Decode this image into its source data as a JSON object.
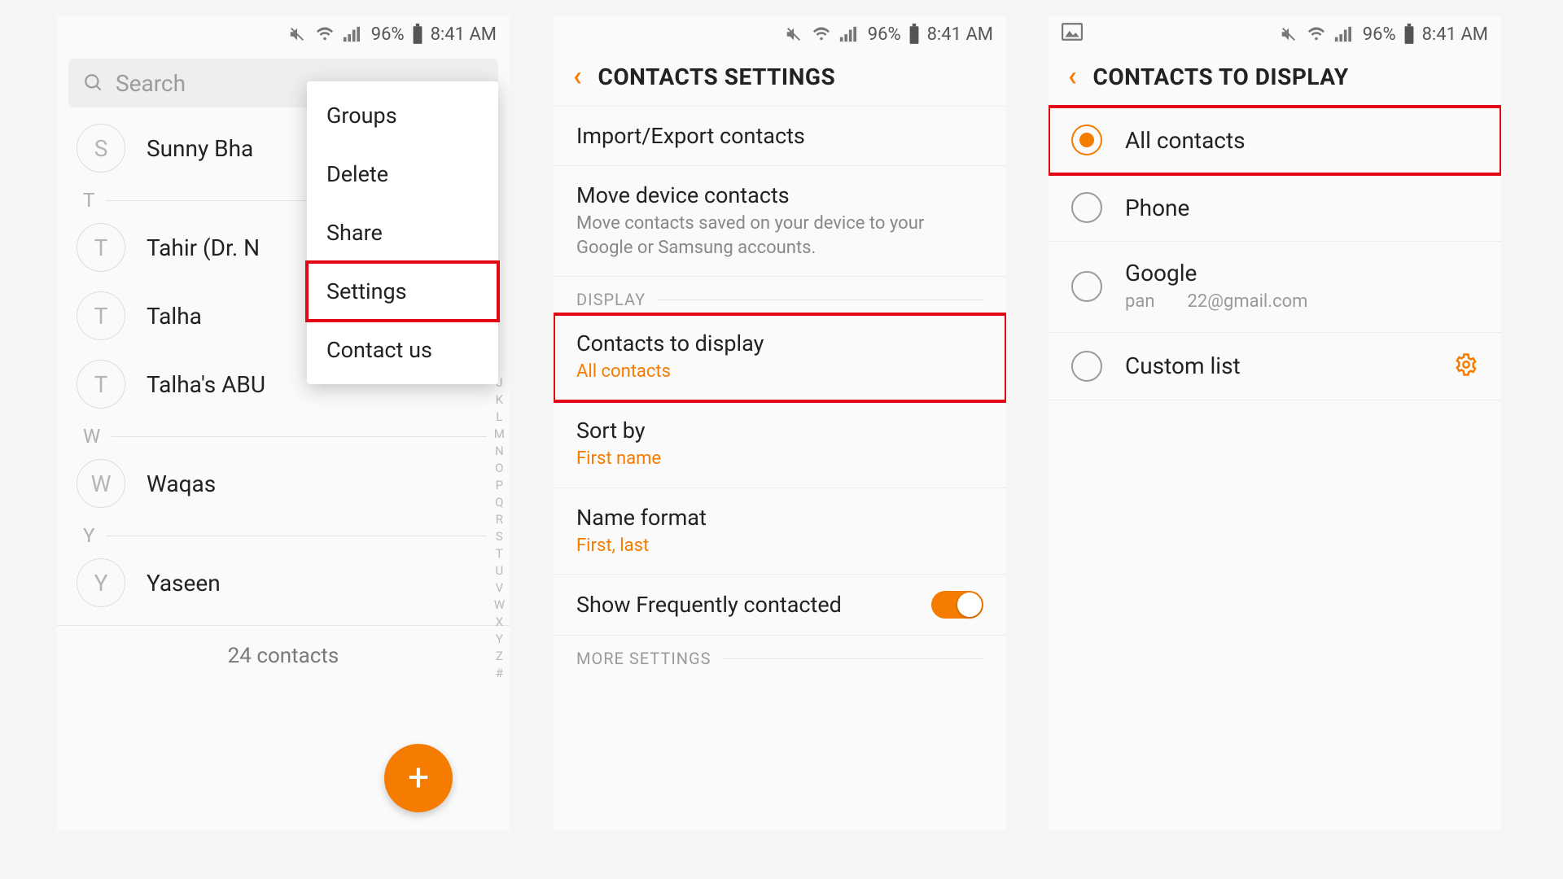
{
  "status": {
    "battery_pct": "96%",
    "time": "8:41 AM"
  },
  "p1": {
    "search_placeholder": "Search",
    "menu": [
      "Groups",
      "Delete",
      "Share",
      "Settings",
      "Contact us"
    ],
    "highlighted_menu_index": 3,
    "sections": [
      {
        "letter": "",
        "contacts": [
          {
            "initial": "S",
            "name": "Sunny Bha"
          }
        ]
      },
      {
        "letter": "T",
        "contacts": [
          {
            "initial": "T",
            "name": "Tahir (Dr. N"
          },
          {
            "initial": "T",
            "name": "Talha"
          },
          {
            "initial": "T",
            "name": "Talha's ABU"
          }
        ]
      },
      {
        "letter": "W",
        "contacts": [
          {
            "initial": "W",
            "name": "Waqas"
          }
        ]
      },
      {
        "letter": "Y",
        "contacts": [
          {
            "initial": "Y",
            "name": "Yaseen"
          }
        ]
      }
    ],
    "footer": "24 contacts",
    "az": [
      "J",
      "K",
      "L",
      "M",
      "N",
      "O",
      "P",
      "Q",
      "R",
      "S",
      "T",
      "U",
      "V",
      "W",
      "X",
      "Y",
      "Z",
      "#"
    ]
  },
  "p2": {
    "title": "CONTACTS SETTINGS",
    "items": [
      {
        "title": "Import/Export contacts"
      },
      {
        "title": "Move device contacts",
        "sub": "Move contacts saved on your device to your Google or Samsung accounts."
      }
    ],
    "section_display": "DISPLAY",
    "display_items": [
      {
        "title": "Contacts to display",
        "sub": "All contacts",
        "highlight": true
      },
      {
        "title": "Sort by",
        "sub": "First name"
      },
      {
        "title": "Name format",
        "sub": "First, last"
      }
    ],
    "freq": {
      "title": "Show Frequently contacted",
      "on": true
    },
    "section_more": "MORE SETTINGS"
  },
  "p3": {
    "title": "CONTACTS TO DISPLAY",
    "options": [
      {
        "label": "All contacts",
        "selected": true,
        "highlight": true
      },
      {
        "label": "Phone"
      },
      {
        "label": "Google",
        "sub_left": "pan",
        "sub_right": "22@gmail.com"
      },
      {
        "label": "Custom list",
        "gear": true
      }
    ]
  }
}
